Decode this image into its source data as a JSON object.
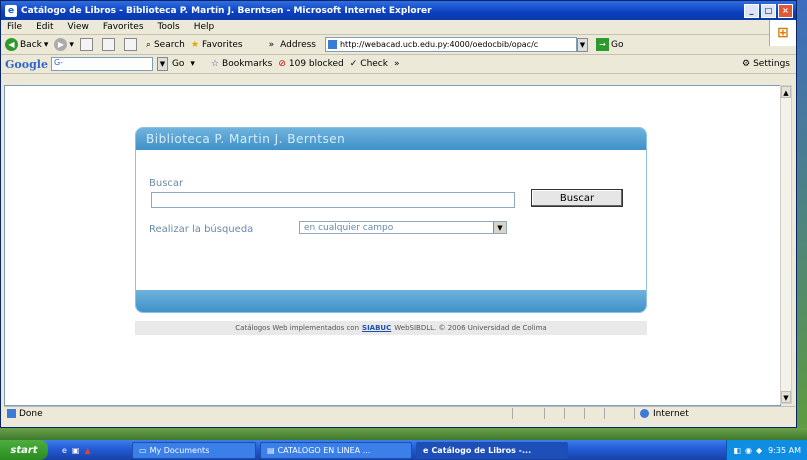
{
  "window": {
    "title": "Catálogo de Libros - Biblioteca P. Martín J. Berntsen - Microsoft Internet Explorer",
    "controls": [
      "_",
      "□",
      "×"
    ]
  },
  "menu": [
    "File",
    "Edit",
    "View",
    "Favorites",
    "Tools",
    "Help"
  ],
  "toolbar": {
    "back": "Back",
    "search": "Search",
    "favorites": "Favorites",
    "chevron": "»",
    "address_label": "Address",
    "address_value": "http://webacad.ucb.edu.py:4000/oedocbib/opac/c",
    "go": "Go"
  },
  "googlebar": {
    "logo": "Google",
    "field": "G-",
    "go": "Go",
    "bookmarks": "Bookmarks",
    "blocked": "109 blocked",
    "check": "Check",
    "chevron": "»",
    "settings": "Settings"
  },
  "page": {
    "panel_title": "Biblioteca P. Martin J. Berntsen",
    "buscar_label": "Buscar",
    "buscar_value": "",
    "buscar_button": "Buscar",
    "realizar_label": "Realizar la búsqueda",
    "select_value": "en cualquier campo",
    "footer_prefix": "Catálogos Web implementados con",
    "footer_link": "SIABUC",
    "footer_suffix": "WebSIBDLL. © 2006 Universidad de Colima"
  },
  "statusbar": {
    "text": "Done",
    "zone": "Internet"
  },
  "taskbar": {
    "start": "start",
    "items": [
      "My Documents",
      "CATALOGO EN LINEA ...",
      "Catálogo de Libros -..."
    ],
    "clock": "9:35 AM"
  }
}
